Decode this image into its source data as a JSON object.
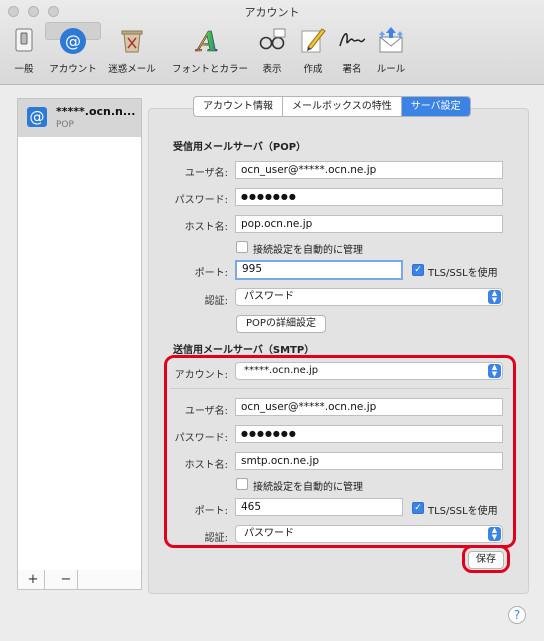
{
  "window": {
    "title": "アカウント"
  },
  "toolbar": [
    {
      "label": "一般",
      "icon": "general-switch-icon"
    },
    {
      "label": "アカウント",
      "icon": "at-sign-icon",
      "selected": true
    },
    {
      "label": "迷惑メール",
      "icon": "junk-trash-icon"
    },
    {
      "label": "フォントとカラー",
      "icon": "font-color-icon"
    },
    {
      "label": "表示",
      "icon": "glasses-icon"
    },
    {
      "label": "作成",
      "icon": "pencil-icon"
    },
    {
      "label": "署名",
      "icon": "signature-icon"
    },
    {
      "label": "ルール",
      "icon": "rules-envelope-icon"
    }
  ],
  "sidebar": {
    "account": {
      "name": "*****.ocn.n...",
      "type": "POP",
      "icon_char": "@"
    },
    "add_label": "+",
    "remove_label": "−"
  },
  "tabs": [
    {
      "label": "アカウント情報",
      "active": false
    },
    {
      "label": "メールボックスの特性",
      "active": false
    },
    {
      "label": "サーバ設定",
      "active": true
    }
  ],
  "incoming": {
    "heading": "受信用メールサーバ（POP）",
    "username_label": "ユーザ名:",
    "username": "ocn_user@*****.ocn.ne.jp",
    "password_label": "パスワード:",
    "password": "●●●●●●●",
    "host_label": "ホスト名:",
    "host": "pop.ocn.ne.jp",
    "auto_manage_label": "接続設定を自動的に管理",
    "port_label": "ポート:",
    "port": "995",
    "tls_label": "TLS/SSLを使用",
    "auth_label": "認証:",
    "auth": "パスワード",
    "advanced_button": "POPの詳細設定"
  },
  "outgoing": {
    "heading": "送信用メールサーバ（SMTP）",
    "account_label": "アカウント:",
    "account": "*****.ocn.ne.jp",
    "username_label": "ユーザ名:",
    "username": "ocn_user@*****.ocn.ne.jp",
    "password_label": "パスワード:",
    "password": "●●●●●●●",
    "host_label": "ホスト名:",
    "host": "smtp.ocn.ne.jp",
    "auto_manage_label": "接続設定を自動的に管理",
    "port_label": "ポート:",
    "port": "465",
    "tls_label": "TLS/SSLを使用",
    "auth_label": "認証:",
    "auth": "パスワード"
  },
  "save_button": "保存",
  "help_button": "?",
  "colors": {
    "accent": "#3b84e6",
    "highlight": "#e0001b"
  }
}
